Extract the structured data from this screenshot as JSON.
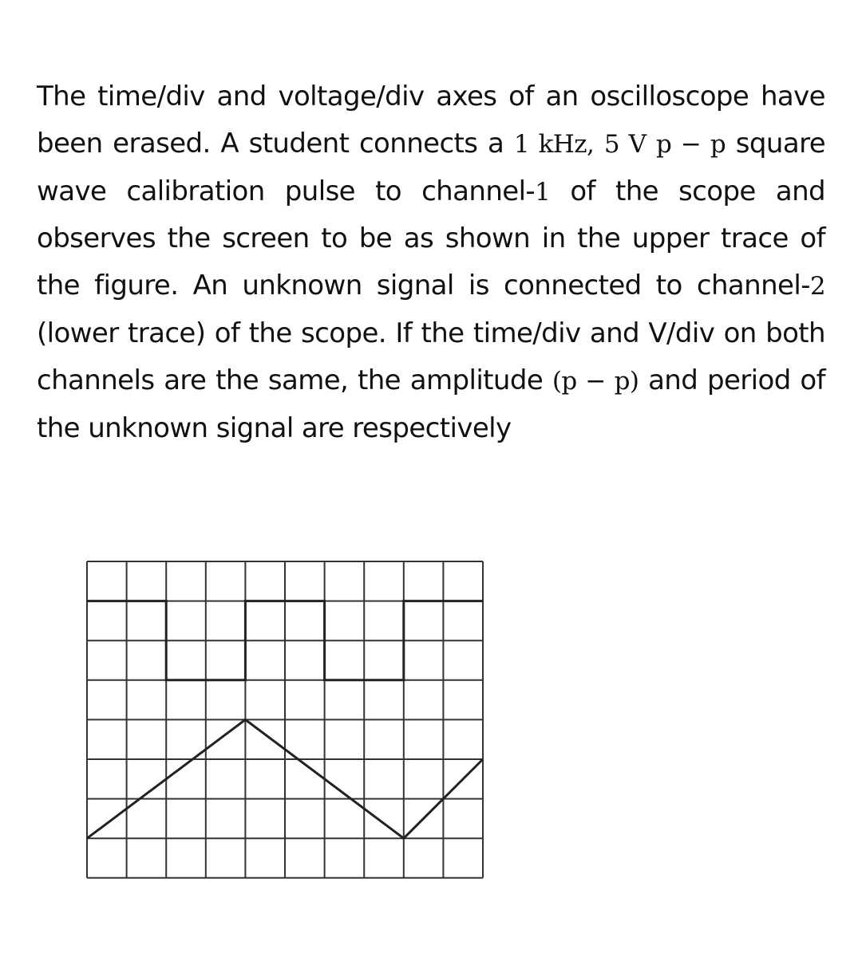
{
  "question": {
    "segments": [
      {
        "t": "The time/div and voltage/div axes of an oscilloscope have been erased. A student connects a ",
        "math": false
      },
      {
        "t": "1 kHz,",
        "math": true
      },
      {
        "t": " ",
        "math": false
      },
      {
        "t": "5 V",
        "math": true
      },
      {
        "t": " ",
        "math": false
      },
      {
        "t": "p − p",
        "math": true
      },
      {
        "t": " square wave calibration pulse to channel-",
        "math": false
      },
      {
        "t": "1",
        "math": true
      },
      {
        "t": " of the scope and observes the screen to be as shown in the upper trace of the figure. An unknown signal is connected to channel-",
        "math": false
      },
      {
        "t": "2",
        "math": true
      },
      {
        "t": " (lower trace) of the scope. If the time/div and V/div on both channels are the same, the amplitude ",
        "math": false
      },
      {
        "t": "(p − p)",
        "math": true
      },
      {
        "t": " and period of the unknown signal are respectively",
        "math": false
      }
    ]
  },
  "figure": {
    "grid": {
      "cols": 10,
      "rows": 8
    },
    "traces": [
      {
        "name": "channel-1-square-wave",
        "type": "square",
        "points_div": [
          [
            0,
            1
          ],
          [
            2,
            1
          ],
          [
            2,
            3
          ],
          [
            4,
            3
          ],
          [
            4,
            1
          ],
          [
            6,
            1
          ],
          [
            6,
            3
          ],
          [
            8,
            3
          ],
          [
            8,
            1
          ],
          [
            10,
            1
          ]
        ],
        "amplitude_div": 2,
        "period_div": 4
      },
      {
        "name": "channel-2-triangle-wave",
        "type": "triangle",
        "points_div": [
          [
            0,
            7
          ],
          [
            4,
            4
          ],
          [
            8,
            7
          ],
          [
            10,
            5
          ]
        ],
        "amplitude_div": 3,
        "period_div": 8
      }
    ],
    "colors": {
      "grid": "#333333",
      "trace": "#222222"
    }
  }
}
